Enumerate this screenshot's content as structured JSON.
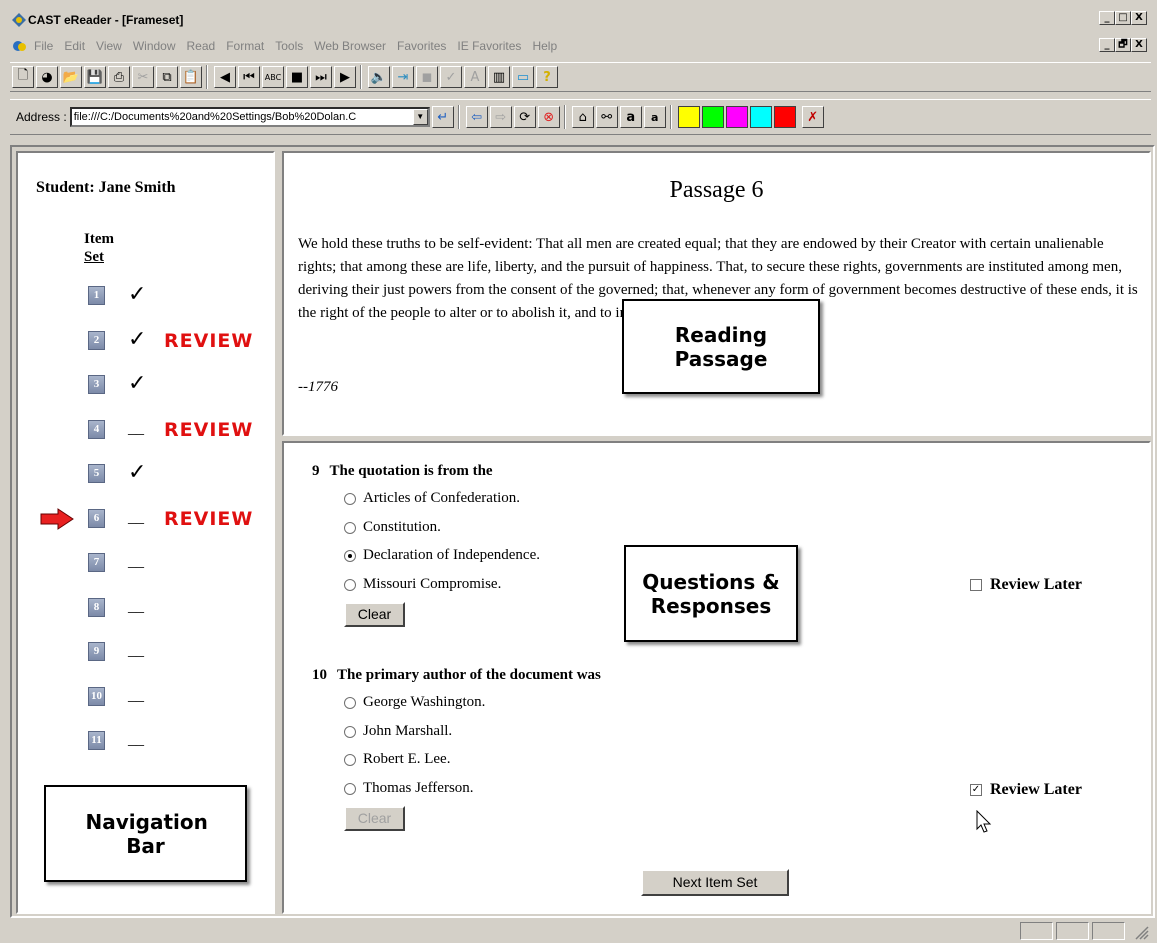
{
  "window": {
    "title": "CAST eReader - [Frameset]",
    "min_label": "_",
    "max_label": "□",
    "close_label": "X",
    "restore_label": "🗗"
  },
  "menu": [
    "File",
    "Edit",
    "View",
    "Window",
    "Read",
    "Format",
    "Tools",
    "Web Browser",
    "Favorites",
    "IE Favorites",
    "Help"
  ],
  "address": {
    "label": "Address :",
    "value": "file:///C:/Documents%20and%20Settings/Bob%20Dolan.C"
  },
  "colors": {
    "highlight_yellow": "#ffff00",
    "highlight_green": "#00ff00",
    "highlight_magenta": "#ff00ff",
    "highlight_cyan": "#00ffff",
    "highlight_red": "#ff0000",
    "review_red": "#e01010"
  },
  "nav": {
    "student": "Student: Jane Smith",
    "header_line1": "Item",
    "header_line2": "Set",
    "items": [
      {
        "num": "1",
        "mark": "✓",
        "review": ""
      },
      {
        "num": "2",
        "mark": "✓",
        "review": "REVIEW"
      },
      {
        "num": "3",
        "mark": "✓",
        "review": ""
      },
      {
        "num": "4",
        "mark": "__",
        "review": "REVIEW"
      },
      {
        "num": "5",
        "mark": "✓",
        "review": ""
      },
      {
        "num": "6",
        "mark": "__",
        "review": "REVIEW",
        "current": true
      },
      {
        "num": "7",
        "mark": "__",
        "review": ""
      },
      {
        "num": "8",
        "mark": "__",
        "review": ""
      },
      {
        "num": "9",
        "mark": "__",
        "review": ""
      },
      {
        "num": "10",
        "mark": "__",
        "review": ""
      },
      {
        "num": "11",
        "mark": "__",
        "review": ""
      }
    ]
  },
  "passage": {
    "title": "Passage 6",
    "text": "We hold these truths to be self-evident: That all men are created equal; that they are endowed by their Creator with certain unalienable rights; that among these are life, liberty, and the pursuit of happiness. That, to secure these rights, governments are instituted among men, deriving their just powers from the consent of the governed; that, whenever any form of government becomes destructive of these ends, it is the right of the people to alter or to abolish it, and to institute new government.",
    "date": "--1776"
  },
  "callouts": {
    "reading": "Reading Passage",
    "questions": "Questions & Responses",
    "navigation": "Navigation Bar"
  },
  "questions": [
    {
      "num": "9",
      "prompt": "The quotation is from the",
      "options": [
        "Articles of Confederation.",
        "Constitution.",
        "Declaration of Independence.",
        "Missouri Compromise."
      ],
      "selected": 2,
      "clear": "Clear",
      "review_later": "Review Later",
      "review_checked": false
    },
    {
      "num": "10",
      "prompt": "The primary author of the document was",
      "options": [
        "George Washington.",
        "John Marshall.",
        "Robert E. Lee.",
        "Thomas Jefferson."
      ],
      "selected": -1,
      "clear": "Clear",
      "review_later": "Review Later",
      "review_checked": true
    }
  ],
  "next_button": "Next Item Set"
}
